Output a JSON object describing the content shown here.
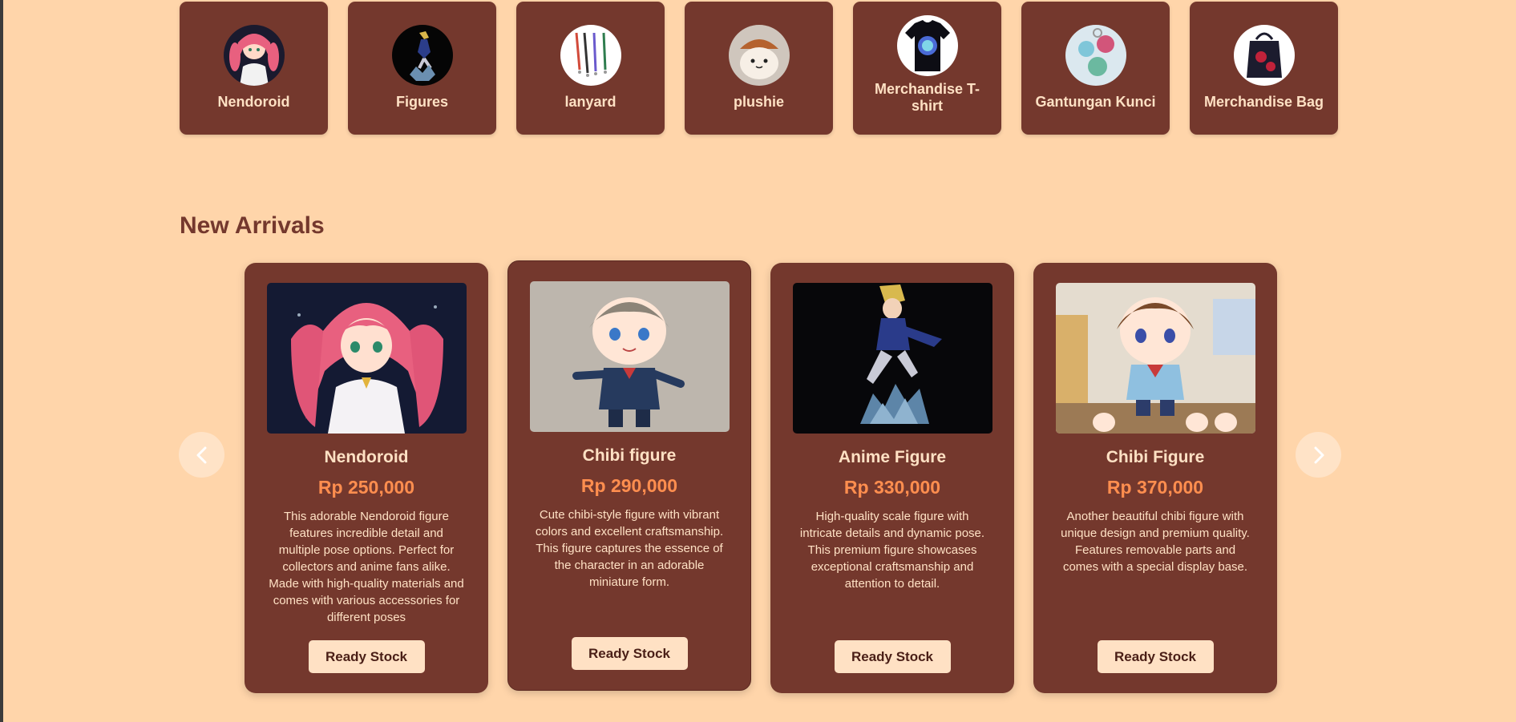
{
  "categories": [
    {
      "label": "Nendoroid",
      "icon": "nendoroid-thumb"
    },
    {
      "label": "Figures",
      "icon": "figures-thumb"
    },
    {
      "label": "lanyard",
      "icon": "lanyard-thumb"
    },
    {
      "label": "plushie",
      "icon": "plushie-thumb"
    },
    {
      "label": "Merchandise T-shirt",
      "icon": "tshirt-thumb"
    },
    {
      "label": "Gantungan Kunci",
      "icon": "keychain-thumb"
    },
    {
      "label": "Merchandise Bag",
      "icon": "bag-thumb"
    }
  ],
  "new_arrivals": {
    "title": "New Arrivals",
    "prev_icon": "chevron-left-icon",
    "next_icon": "chevron-right-icon",
    "products": [
      {
        "name": "Nendoroid",
        "price": "Rp 250,000",
        "description": "This adorable Nendoroid figure features incredible detail and multiple pose options. Perfect for collectors and anime fans alike. Made with high-quality materials and comes with various accessories for different poses",
        "button": "Ready Stock"
      },
      {
        "name": "Chibi figure",
        "price": "Rp 290,000",
        "description": "Cute chibi-style figure with vibrant colors and excellent craftsmanship. This figure captures the essence of the character in an adorable miniature form.",
        "button": "Ready Stock"
      },
      {
        "name": "Anime Figure",
        "price": "Rp 330,000",
        "description": "High-quality scale figure with intricate details and dynamic pose. This premium figure showcases exceptional craftsmanship and attention to detail.",
        "button": "Ready Stock"
      },
      {
        "name": "Chibi Figure",
        "price": "Rp 370,000",
        "description": "Another beautiful chibi figure with unique design and premium quality. Features removable parts and comes with a special display base.",
        "button": "Ready Stock"
      }
    ]
  },
  "colors": {
    "background": "#ffd5aa",
    "card": "#74382d",
    "card_text": "#ffe1c4",
    "price": "#ff8e4f",
    "title": "#74382d"
  }
}
